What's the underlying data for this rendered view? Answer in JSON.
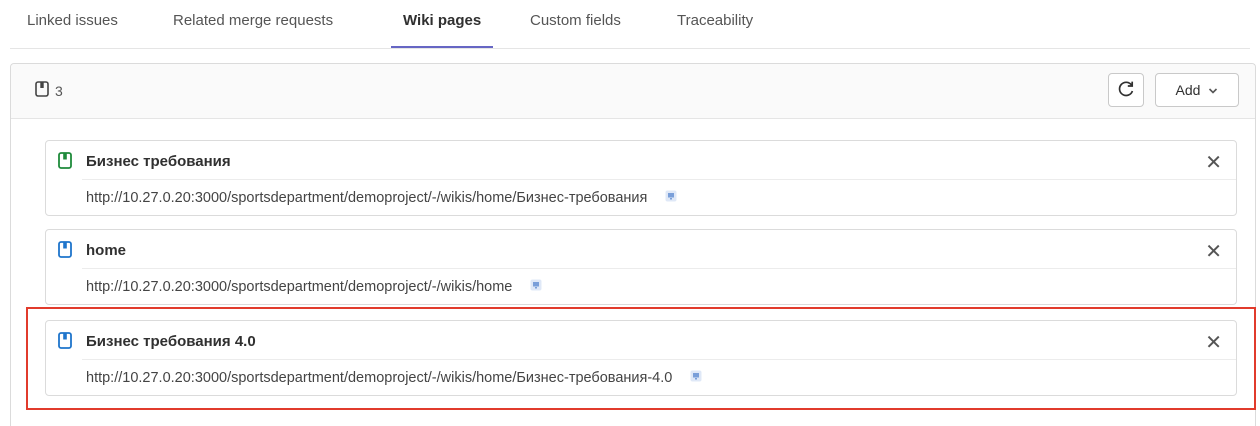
{
  "tabs": [
    {
      "label": "Linked issues",
      "active": false
    },
    {
      "label": "Related merge requests",
      "active": false
    },
    {
      "label": "Wiki pages",
      "active": true
    },
    {
      "label": "Custom fields",
      "active": false
    },
    {
      "label": "Traceability",
      "active": false
    }
  ],
  "panel": {
    "count": "3",
    "refresh_icon": "refresh-icon",
    "add_label": "Add",
    "add_icon": "chevron-down-icon"
  },
  "wiki_pages": [
    {
      "title": "Бизнес требования",
      "url": "http://10.27.0.20:3000/sportsdepartment/demoproject/-/wikis/home/Бизнес-требования",
      "icon": "wiki-page-icon",
      "icon_color": "#1f8a3b"
    },
    {
      "title": "home",
      "url": "http://10.27.0.20:3000/sportsdepartment/demoproject/-/wikis/home",
      "icon": "wiki-page-icon",
      "icon_color": "#1f75cb"
    },
    {
      "title": "Бизнес требования 4.0",
      "url": "http://10.27.0.20:3000/sportsdepartment/demoproject/-/wikis/home/Бизнес-требования-4.0",
      "icon": "wiki-page-icon",
      "icon_color": "#1f75cb"
    }
  ],
  "colors": {
    "tab_active_underline": "#6666c4",
    "highlight_box": "#e13b2c"
  }
}
